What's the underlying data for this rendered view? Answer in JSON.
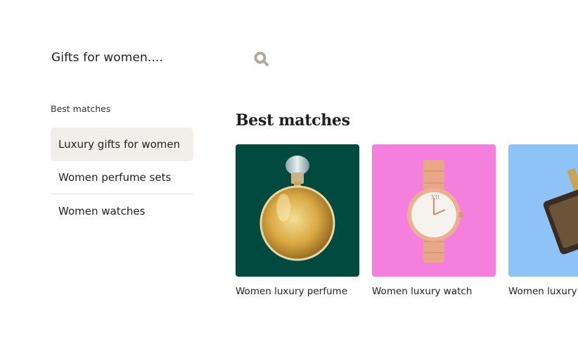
{
  "search": {
    "value": "Gifts for women...."
  },
  "sidebar": {
    "heading": "Best matches",
    "items": [
      {
        "label": "Luxury gifts for women"
      },
      {
        "label": "Women perfume sets"
      },
      {
        "label": "Women watches"
      }
    ]
  },
  "main": {
    "title": "Best matches",
    "cards": [
      {
        "label": "Women luxury perfume",
        "image": "perfume-bottle",
        "bg": "#004a40"
      },
      {
        "label": "Women luxury watch",
        "image": "wristwatch",
        "bg": "#f47fdc"
      },
      {
        "label": "Women luxury",
        "image": "ornate-perfume-bottle",
        "bg": "#8ec3f8"
      }
    ]
  },
  "colors": {
    "accent": "#b5a99b",
    "active_bg": "#f2efeb"
  }
}
